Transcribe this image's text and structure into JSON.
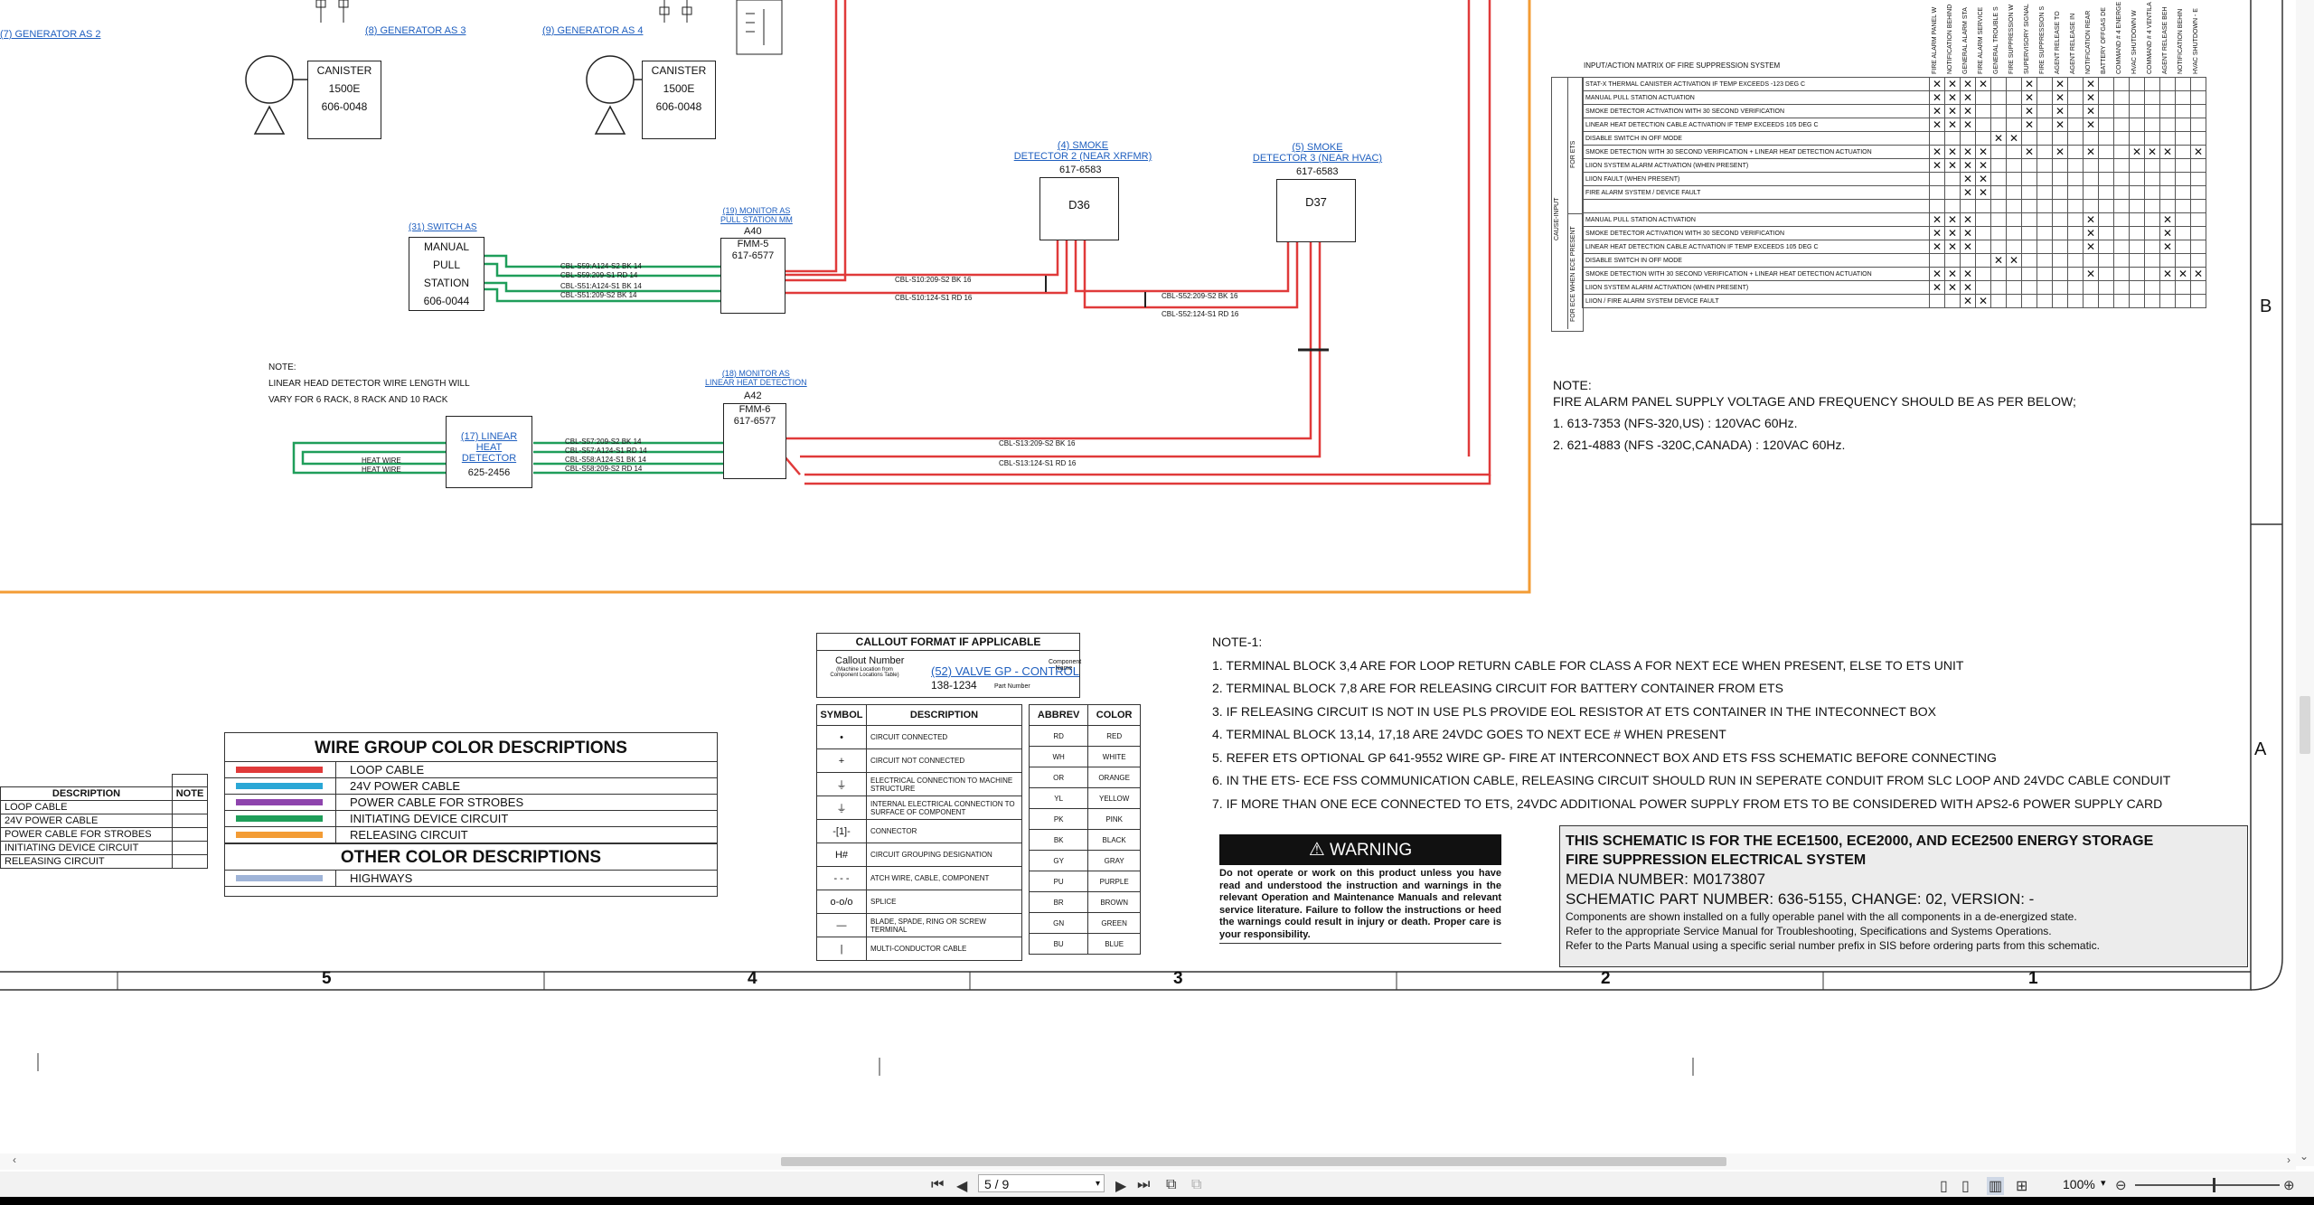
{
  "schematic": {
    "generator_as2": "(7) GENERATOR AS 2",
    "generator_as3": "(8) GENERATOR AS 3",
    "generator_as4": "(9) GENERATOR AS 4",
    "canister1": {
      "line1": "CANISTER",
      "line2": "1500E",
      "line3": "606-0048"
    },
    "canister2": {
      "line1": "CANISTER",
      "line2": "1500E",
      "line3": "606-0048"
    },
    "switch_as": "(31) SWITCH AS",
    "manual_station": {
      "l1": "MANUAL",
      "l2": "PULL",
      "l3": "STATION",
      "l4": "606-0044"
    },
    "monitor_pull": {
      "l1": "(19) MONITOR AS",
      "l2": "PULL STATION MM"
    },
    "fmm5": {
      "addr": "A40",
      "name": "FMM-5",
      "part": "617-6577"
    },
    "smoke2": {
      "l1": "(4) SMOKE",
      "l2": "DETECTOR 2 (NEAR XRFMR)",
      "part": "617-6583",
      "id": "D36"
    },
    "smoke3": {
      "l1": "(5) SMOKE",
      "l2": "DETECTOR 3 (NEAR HVAC)",
      "part": "617-6583",
      "id": "D37"
    },
    "monitor_lhd": {
      "l1": "(18) MONITOR AS",
      "l2": "LINEAR HEAT DETECTION"
    },
    "fmm6": {
      "addr": "A42",
      "name": "FMM-6",
      "part": "617-6577"
    },
    "linear_heat": {
      "l1": "(17) LINEAR",
      "l2": "HEAT",
      "l3": "DETECTOR",
      "part": "625-2456"
    },
    "heat_wire1": "HEAT WIRE",
    "heat_wire2": "HEAT WIRE",
    "note_left": {
      "l1": "NOTE:",
      "l2": "LINEAR HEAD DETECTOR WIRE LENGTH WILL",
      "l3": "VARY FOR 6 RACK, 8 RACK AND 10 RACK"
    },
    "cables_switch": [
      "CBL-S59:A124-S2 BK 14",
      "CBL-S59:209-S1 RD 14",
      "CBL-S51:A124-S1 BK 14",
      "CBL-S51:209-S2 BK 14"
    ],
    "cables_fmm5_out": [
      "CBL-S10:209-S2 BK 16",
      "CBL-S10:124-S1 RD 16"
    ],
    "cables_smoke": [
      "CBL-S52:209-S2 BK 16",
      "CBL-S52:124-S1 RD 16"
    ],
    "cables_lhd": [
      "CBL-S57:209-S2 BK 14",
      "CBL-S57:A124-S1 RD 14",
      "CBL-S58:A124-S1 BK 14",
      "CBL-S58:209-S2 RD 14"
    ],
    "cables_fmm6_out": [
      "CBL-S13:209-S2 BK 16",
      "CBL-S13:124-S1 RD 16"
    ]
  },
  "matrix": {
    "title": "INPUT/ACTION MATRIX OF FIRE SUPPRESSION SYSTEM",
    "side_for_ets": "FOR ETS",
    "side_cause": "CAUSE-INPUT",
    "side_for_ece": "FOR ECE WHEN ECE PRESENT",
    "columns": [
      "FIRE ALARM PANEL W",
      "NOTIFICATION BEHIND",
      "GENERAL ALARM STA",
      "FIRE ALARM SERVICE",
      "GENERAL TROUBLE S",
      "FIRE SUPPRESSION W",
      "SUPERVISORY SIGNAL",
      "FIRE SUPPRESSION S",
      "AGENT RELEASE TO",
      "AGENT RELEASE IN",
      "NOTIFICATION REAR",
      "BATTERY OFFGAS DE",
      "COMMAND # 4 ENERGE",
      "HVAC SHUTDOWN W",
      "COMMAND # 4 VENTILA",
      "AGENT RELEASE BEH",
      "NOTIFICATION BEHIN",
      "HVAC SHUTDOWN - E"
    ],
    "rows": [
      "STAT-X THERMAL CANISTER ACTIVATION IF TEMP EXCEEDS -123 DEG C",
      "MANUAL PULL STATION ACTUATION",
      "SMOKE DETECTOR ACTIVATION WITH 30 SECOND VERIFICATION",
      "LINEAR HEAT DETECTION CABLE ACTIVATION IF TEMP EXCEEDS 105 DEG C",
      "DISABLE SWITCH IN OFF MODE",
      "SMOKE DETECTION WITH 30 SECOND VERIFICATION + LINEAR HEAT DETECTION ACTUATION",
      "LIION SYSTEM ALARM ACTIVATION (WHEN PRESENT)",
      "LIION FAULT (WHEN PRESENT)",
      "FIRE ALARM SYSTEM / DEVICE FAULT",
      "",
      "MANUAL PULL STATION ACTIVATION",
      "SMOKE DETECTOR ACTIVATION WITH 30 SECOND VERIFICATION",
      "LINEAR HEAT DETECTION CABLE ACTIVATION IF TEMP EXCEEDS 105 DEG C",
      "DISABLE SWITCH IN OFF MODE",
      "SMOKE DETECTION WITH 30 SECOND VERIFICATION + LINEAR HEAT DETECTION ACTUATION",
      "LIION SYSTEM ALARM ACTIVATION (WHEN PRESENT)",
      "LIION / FIRE ALARM SYSTEM DEVICE FAULT"
    ],
    "marks": [
      [
        0,
        1,
        2,
        3,
        6,
        8,
        10
      ],
      [
        0,
        1,
        2,
        6,
        8,
        10
      ],
      [
        0,
        1,
        2,
        6,
        8,
        10
      ],
      [
        0,
        1,
        2,
        6,
        8,
        10
      ],
      [
        4,
        5
      ],
      [
        0,
        1,
        2,
        3,
        6,
        8,
        10,
        13,
        14,
        15,
        17
      ],
      [
        0,
        1,
        2,
        3
      ],
      [
        2,
        3
      ],
      [
        2,
        3
      ],
      [],
      [
        0,
        1,
        2,
        10,
        15
      ],
      [
        0,
        1,
        2,
        10,
        15
      ],
      [
        0,
        1,
        2,
        10,
        15
      ],
      [
        4,
        5
      ],
      [
        0,
        1,
        2,
        10,
        15,
        16,
        17
      ],
      [
        0,
        1,
        2
      ],
      [
        2,
        3
      ]
    ]
  },
  "zone_labels": {
    "b": "B",
    "a": "A"
  },
  "note_power": {
    "title": "NOTE:",
    "l1": "FIRE ALARM PANEL SUPPLY VOLTAGE AND FREQUENCY SHOULD BE AS PER BELOW;",
    "l2": "1. 613-7353 (NFS-320,US) : 120VAC 60Hz.",
    "l3": "2. 621-4883 (NFS -320C,CANADA) : 120VAC 60Hz."
  },
  "note1": {
    "title": "NOTE-1:",
    "items": [
      "1. TERMINAL BLOCK 3,4 ARE FOR LOOP RETURN CABLE FOR CLASS A FOR NEXT ECE WHEN PRESENT, ELSE TO ETS UNIT",
      "2. TERMINAL BLOCK 7,8 ARE FOR RELEASING CIRCUIT FOR BATTERY CONTAINER FROM ETS",
      "3. IF RELEASING CIRCUIT IS NOT IN USE PLS PROVIDE EOL RESISTOR AT ETS CONTAINER IN THE INTECONNECT BOX",
      "4. TERMINAL BLOCK 13,14, 17,18 ARE 24VDC GOES TO NEXT ECE # WHEN PRESENT",
      "5. REFER ETS OPTIONAL GP 641-9552 WIRE GP- FIRE AT INTERCONNECT BOX AND ETS FSS SCHEMATIC BEFORE CONNECTING",
      "6. IN THE ETS- ECE FSS COMMUNICATION CABLE, RELEASING CIRCUIT SHOULD RUN IN SEPERATE CONDUIT FROM SLC LOOP AND 24VDC CABLE CONDUIT",
      "7. IF MORE THAN ONE ECE CONNECTED TO ETS, 24VDC ADDITIONAL POWER SUPPLY FROM ETS TO BE CONSIDERED WITH APS2-6 POWER SUPPLY CARD"
    ]
  },
  "left_table": {
    "headers": [
      "DESCRIPTION",
      "NOTE"
    ],
    "rows": [
      "LOOP CABLE",
      "24V POWER CABLE",
      "POWER CABLE FOR STROBES",
      "INITIATING DEVICE CIRCUIT",
      "RELEASING CIRCUIT"
    ]
  },
  "wire_colors": {
    "title": "WIRE GROUP COLOR DESCRIPTIONS",
    "items": [
      {
        "color": "#e03a3a",
        "label": "LOOP CABLE"
      },
      {
        "color": "#2aa7d6",
        "label": "24V POWER CABLE"
      },
      {
        "color": "#8e44ad",
        "label": "POWER CABLE FOR STROBES"
      },
      {
        "color": "#1f9e5a",
        "label": "INITIATING DEVICE CIRCUIT"
      },
      {
        "color": "#f39c35",
        "label": "RELEASING CIRCUIT"
      }
    ],
    "other_title": "OTHER COLOR DESCRIPTIONS",
    "other_items": [
      {
        "color": "#9fb4d8",
        "label": "HIGHWAYS"
      }
    ]
  },
  "callout": {
    "title": "CALLOUT FORMAT IF APPLICABLE",
    "callout_number": "Callout Number",
    "callout_sub": "(Machine Location from Component Locations Table)",
    "example": "(52) VALVE GP - CONTROL",
    "component_name": "Component Name",
    "part_number_value": "138-1234",
    "part_number_label": "Part Number"
  },
  "symbols": {
    "headers": [
      "SYMBOL",
      "DESCRIPTION"
    ],
    "rows": [
      {
        "sym": "•",
        "desc": "CIRCUIT CONNECTED"
      },
      {
        "sym": "+",
        "desc": "CIRCUIT NOT CONNECTED"
      },
      {
        "sym": "⏚",
        "desc": "ELECTRICAL CONNECTION TO MACHINE STRUCTURE"
      },
      {
        "sym": "⏚",
        "desc": "INTERNAL ELECTRICAL CONNECTION TO SURFACE OF COMPONENT"
      },
      {
        "sym": "-[1]-",
        "desc": "CONNECTOR"
      },
      {
        "sym": "H#",
        "desc": "CIRCUIT GROUPING DESIGNATION"
      },
      {
        "sym": "- - -",
        "desc": "ATCH WIRE, CABLE, COMPONENT"
      },
      {
        "sym": "o-o/o",
        "desc": "SPLICE"
      },
      {
        "sym": "—",
        "desc": "BLADE, SPADE, RING OR SCREW TERMINAL"
      },
      {
        "sym": "|",
        "desc": "MULTI-CONDUCTOR CABLE"
      }
    ]
  },
  "abbrev": {
    "headers": [
      "ABBREV",
      "COLOR"
    ],
    "rows": [
      [
        "RD",
        "RED"
      ],
      [
        "WH",
        "WHITE"
      ],
      [
        "OR",
        "ORANGE"
      ],
      [
        "YL",
        "YELLOW"
      ],
      [
        "PK",
        "PINK"
      ],
      [
        "BK",
        "BLACK"
      ],
      [
        "GY",
        "GRAY"
      ],
      [
        "PU",
        "PURPLE"
      ],
      [
        "BR",
        "BROWN"
      ],
      [
        "GN",
        "GREEN"
      ],
      [
        "BU",
        "BLUE"
      ]
    ]
  },
  "warning": {
    "title": "WARNING",
    "text": "Do not operate or work on this product unless you have read and understood the instruction and warnings in the relevant Operation and Maintenance Manuals and relevant service literature. Failure to follow the instructions or heed the warnings could result in injury or death. Proper care is your responsibility."
  },
  "title_block": {
    "l1": "THIS SCHEMATIC IS FOR THE ECE1500, ECE2000, AND ECE2500 ENERGY STORAGE",
    "l2": "FIRE SUPPRESSION ELECTRICAL SYSTEM",
    "l3": "MEDIA NUMBER: M0173807",
    "l4": "SCHEMATIC PART NUMBER: 636-5155, CHANGE: 02, VERSION: -",
    "l5": "Components are shown installed on a fully operable panel with the all components in a de-energized state.",
    "l6": "Refer to the appropriate Service Manual for Troubleshooting, Specifications and Systems Operations.",
    "l7": "Refer to the Parts Manual using a specific serial number prefix in SIS before ordering parts from this schematic."
  },
  "columns_ruler": [
    "5",
    "4",
    "3",
    "2",
    "1"
  ],
  "viewer": {
    "page_value": "5 / 9",
    "zoom_value": "100%",
    "colors": {
      "toolbar": "#f2f2f2",
      "scroll_thumb": "#c8c8c8"
    }
  }
}
